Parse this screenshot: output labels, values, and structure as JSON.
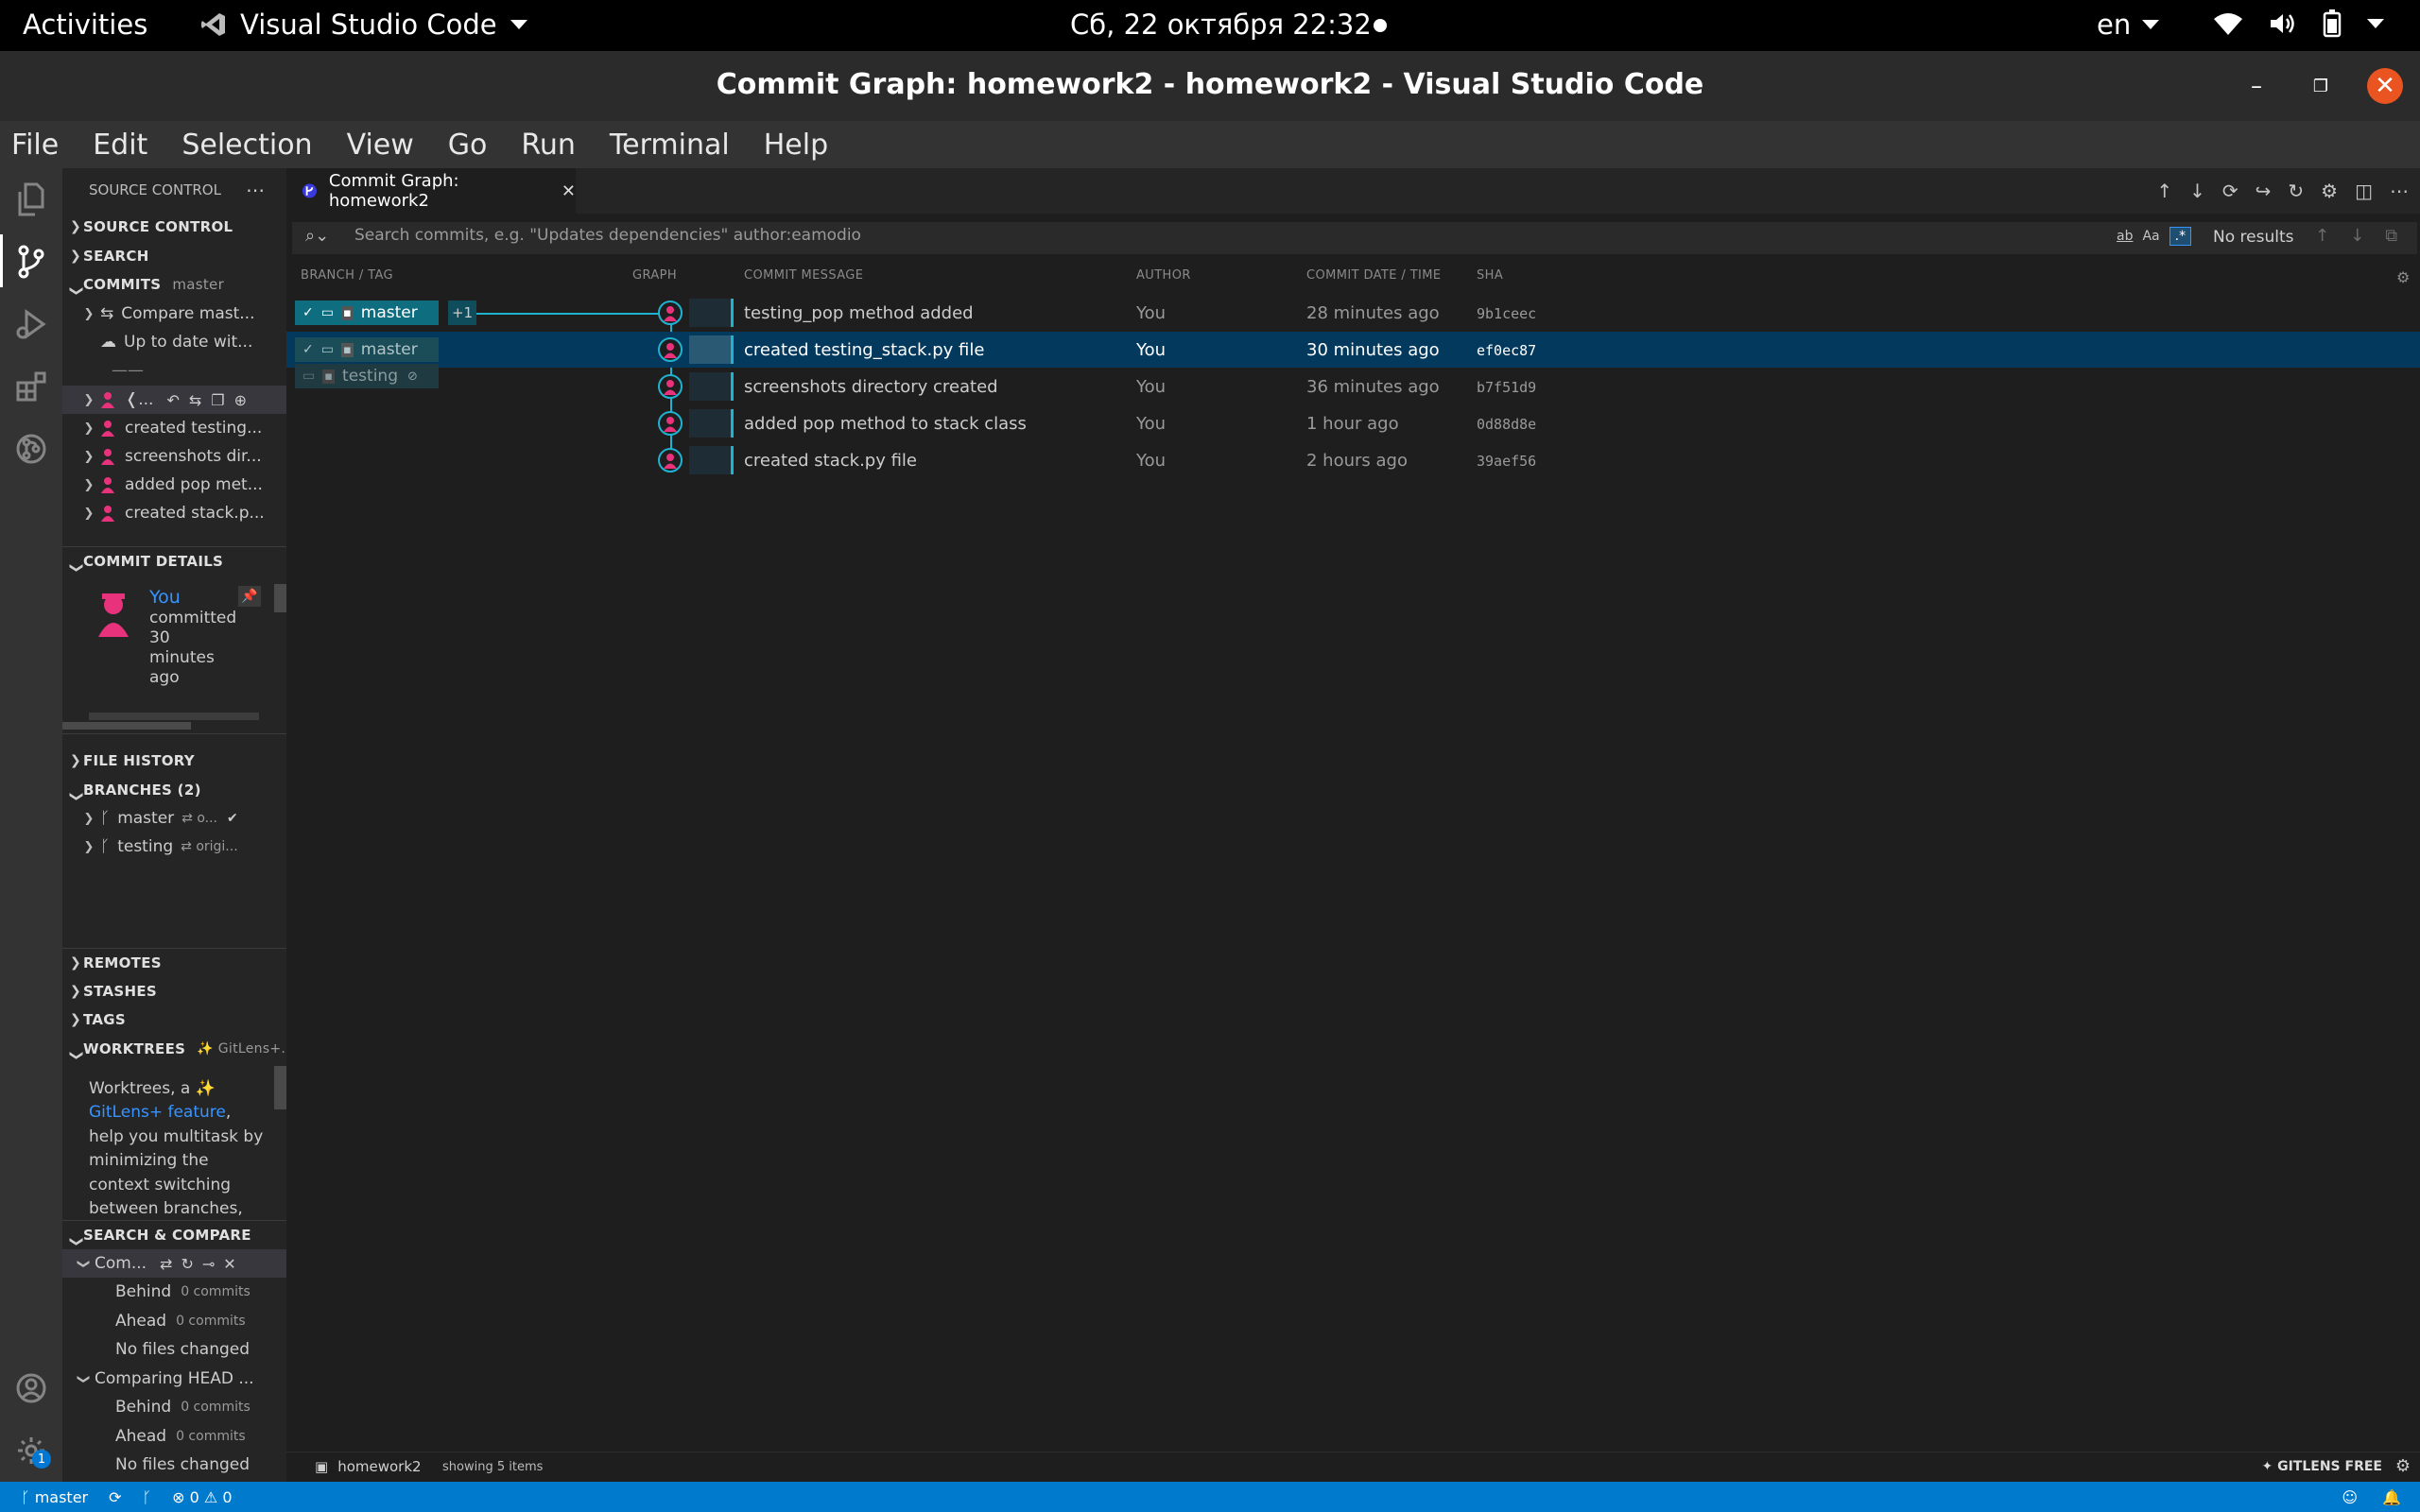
{
  "topbar": {
    "activities": "Activities",
    "app_name": "Visual Studio Code",
    "clock": "Сб, 22 октября  22:32",
    "lang": "en"
  },
  "window": {
    "title": "Commit Graph: homework2 - homework2 - Visual Studio Code"
  },
  "menu": [
    "File",
    "Edit",
    "Selection",
    "View",
    "Go",
    "Run",
    "Terminal",
    "Help"
  ],
  "sidebar": {
    "header": "SOURCE CONTROL",
    "sections": {
      "source_control": "SOURCE CONTROL",
      "search": "SEARCH",
      "commits": "COMMITS",
      "commits_branch": "master",
      "commit_details": "COMMIT DETAILS",
      "file_history": "FILE HISTORY",
      "branches": "BRANCHES (2)",
      "remotes": "REMOTES",
      "stashes": "STASHES",
      "tags": "TAGS",
      "worktrees": "WORKTREES",
      "worktrees_sub": "✨ GitLens+...",
      "search_compare": "SEARCH & COMPARE"
    },
    "commits_items": {
      "compare": "Compare mast...",
      "uptodate": "Up to date wit...",
      "dash": "——",
      "current": "❬...",
      "list": [
        "created testing...",
        "screenshots dir...",
        "added pop met...",
        "created stack.p..."
      ]
    },
    "commit_details": {
      "author": "You",
      "line1": "committed",
      "line2": "30",
      "line3": "minutes",
      "line4": "ago"
    },
    "branches": [
      {
        "name": "master",
        "tracking": "⇄ o...",
        "check": "✔"
      },
      {
        "name": "testing",
        "tracking": "⇄ origi..."
      }
    ],
    "worktrees_text": {
      "l1": "Worktrees, a ✨",
      "link": "GitLens+ feature",
      "comma": ",",
      "l2": "help you multitask by",
      "l3": "minimizing the",
      "l4": "context switching",
      "l5": "between branches,"
    },
    "compare": {
      "group1": "Com...",
      "group2": "Comparing HEAD ...",
      "behind": "Behind",
      "ahead": "Ahead",
      "zero": "0 commits",
      "nofiles": "No files changed"
    }
  },
  "editor": {
    "tab_title": "Commit Graph: homework2",
    "search_placeholder": "Search commits, e.g. \"Updates dependencies\" author:eamodio",
    "search_results": "No results",
    "columns": [
      "BRANCH / TAG",
      "GRAPH",
      "COMMIT MESSAGE",
      "AUTHOR",
      "COMMIT DATE / TIME",
      "SHA"
    ],
    "branch_tags": {
      "master_head": "master",
      "plus": "+1",
      "master2": "master",
      "testing": "testing"
    },
    "commits": [
      {
        "message": "testing_pop method added",
        "author": "You",
        "date": "28 minutes ago",
        "sha": "9b1ceec"
      },
      {
        "message": "created testing_stack.py file",
        "author": "You",
        "date": "30 minutes ago",
        "sha": "ef0ec87",
        "selected": true
      },
      {
        "message": "screenshots directory created",
        "author": "You",
        "date": "36 minutes ago",
        "sha": "b7f51d9"
      },
      {
        "message": "added pop method to stack class",
        "author": "You",
        "date": "1 hour ago",
        "sha": "0d88d8e"
      },
      {
        "message": "created stack.py file",
        "author": "You",
        "date": "2 hours ago",
        "sha": "39aef56"
      }
    ],
    "panel_workspace": "homework2",
    "panel_count": "showing 5 items",
    "gitlens_free": "GITLENS FREE"
  },
  "statusbar": {
    "branch": "master",
    "problems": "⊗ 0 ⚠ 0"
  },
  "colors": {
    "accent": "#007acc",
    "graph_line": "#1fb3d2",
    "selection": "#04395e",
    "avatar": "#e8327c"
  }
}
